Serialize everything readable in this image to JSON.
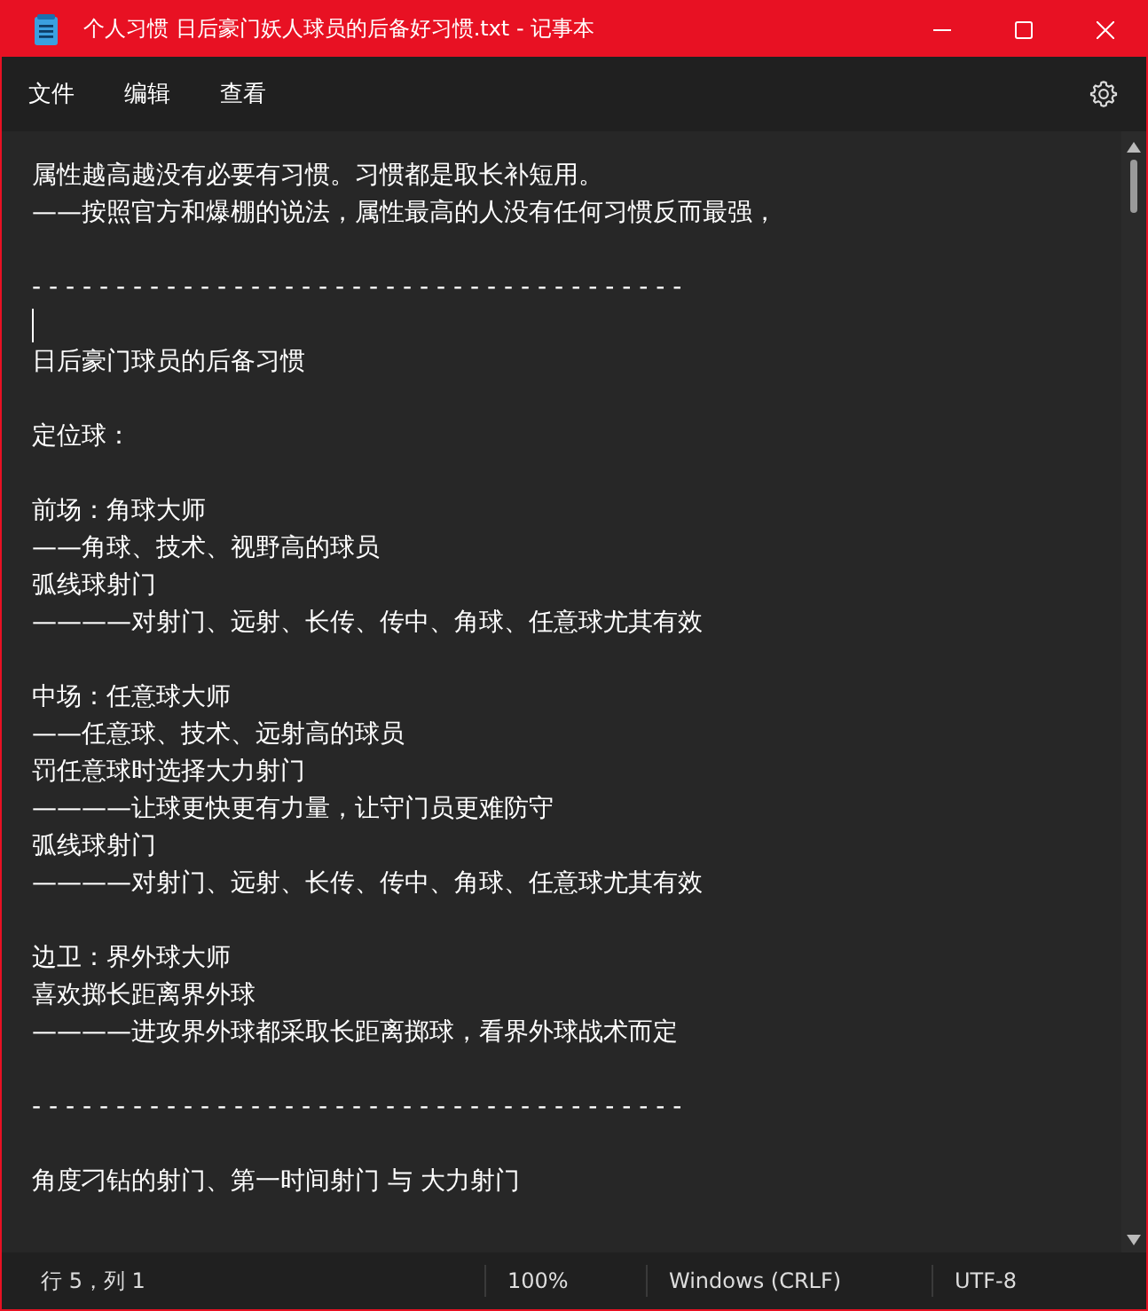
{
  "window": {
    "title": "个人习惯 日后豪门妖人球员的后备好习惯.txt - 记事本"
  },
  "menu": [
    "文件",
    "编辑",
    "查看"
  ],
  "editor": {
    "lines": [
      {
        "kind": "text",
        "text": "属性越高越没有必要有习惯。习惯都是取长补短用。"
      },
      {
        "kind": "text",
        "text": "——按照官方和爆棚的说法，属性最高的人没有任何习惯反而最强，"
      },
      {
        "kind": "blank"
      },
      {
        "kind": "text",
        "text": "- - - - - - - - - - - - - - - - - - - - - - - - - - - - - - - - - - - - - - -"
      },
      {
        "kind": "caret"
      },
      {
        "kind": "text",
        "text": "日后豪门球员的后备习惯"
      },
      {
        "kind": "blank"
      },
      {
        "kind": "text",
        "text": "定位球："
      },
      {
        "kind": "blank"
      },
      {
        "kind": "text",
        "text": "前场：角球大师"
      },
      {
        "kind": "text",
        "text": "——角球、技术、视野高的球员"
      },
      {
        "kind": "text",
        "text": "弧线球射门"
      },
      {
        "kind": "text",
        "text": "————对射门、远射、长传、传中、角球、任意球尤其有效"
      },
      {
        "kind": "blank"
      },
      {
        "kind": "text",
        "text": "中场：任意球大师"
      },
      {
        "kind": "text",
        "text": "——任意球、技术、远射高的球员"
      },
      {
        "kind": "text",
        "text": "罚任意球时选择大力射门"
      },
      {
        "kind": "text",
        "text": "————让球更快更有力量，让守门员更难防守"
      },
      {
        "kind": "text",
        "text": "弧线球射门"
      },
      {
        "kind": "text",
        "text": "————对射门、远射、长传、传中、角球、任意球尤其有效"
      },
      {
        "kind": "blank"
      },
      {
        "kind": "text",
        "text": "边卫：界外球大师"
      },
      {
        "kind": "text",
        "text": "喜欢掷长距离界外球"
      },
      {
        "kind": "text",
        "text": "————进攻界外球都采取长距离掷球，看界外球战术而定"
      },
      {
        "kind": "blank"
      },
      {
        "kind": "text",
        "text": "- - - - - - - - - - - - - - - - - - - - - - - - - - - - - - - - - - - - - - -"
      },
      {
        "kind": "blank"
      },
      {
        "kind": "text",
        "text": "角度刁钻的射门、第一时间射门 与 大力射门"
      },
      {
        "kind": "blank"
      }
    ]
  },
  "status_bar": {
    "position": "行 5，列 1",
    "zoom": "100%",
    "line_ending": "Windows (CRLF)",
    "encoding": "UTF-8"
  }
}
